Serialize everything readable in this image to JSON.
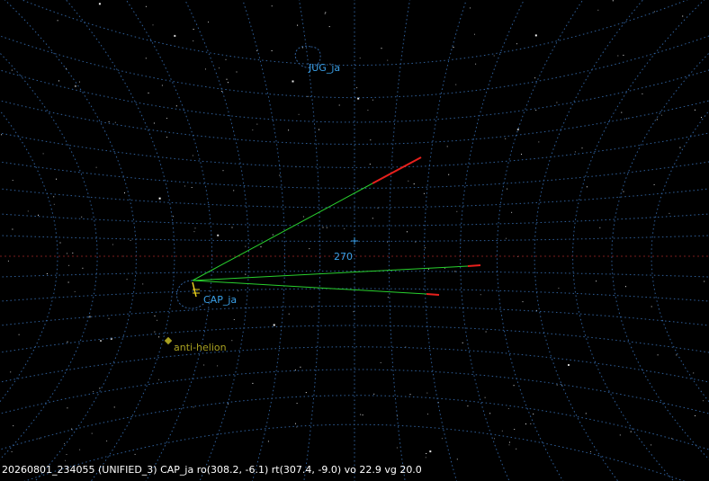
{
  "labels": {
    "radiant_top": "JUG_ja",
    "radiant_main": "CAP_ja",
    "anti_helion": "anti-helion",
    "azimuth_marker": "270"
  },
  "status_line": "20260801_234055 (UNIFIED_3) CAP_ja ro(308.2, -6.1) rt(307.4, -9.0) vo 22.9 vg 20.0",
  "colors": {
    "background": "#000000",
    "grid": "#2f5f9a",
    "horizon": "#7a1c1c",
    "radiant_label": "#3aa0e8",
    "anti_helion": "#a8a020",
    "meteor_trail": "#29d12e",
    "meteor_head": "#e8201c",
    "status_text": "#ffffff",
    "star": "#d0d0d0"
  },
  "icons": {
    "anti_helion": "diamond-icon",
    "azimuth_marker": "crosshair-icon"
  }
}
